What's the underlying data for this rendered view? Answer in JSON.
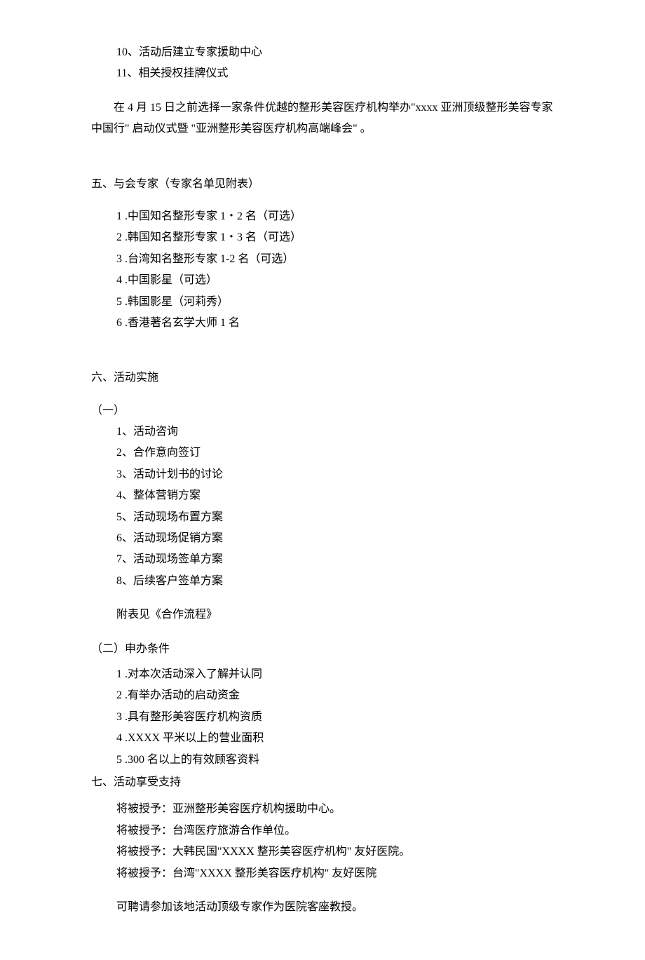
{
  "top_items": [
    "10、活动后建立专家援助中心",
    "11、相关授权挂牌仪式"
  ],
  "intro_para": "在 4 月 15 日之前选择一家条件优越的整形美容医疗机构举办\"xxxx 亚洲顶级整形美容专家中国行\" 启动仪式暨 \"亚洲整形美容医疗机构高端峰会\" 。",
  "section5": {
    "title": "五、与会专家（专家名单见附表）",
    "items": [
      "1  .中国知名整形专家 1・2 名（可选）",
      "2  .韩国知名整形专家 1・3 名（可选）",
      "3  .台湾知名整形专家 1-2 名（可选）",
      "4  .中国影星（可选）",
      "5  .韩国影星（河莉秀）",
      "6  .香港著名玄学大师 1 名"
    ]
  },
  "section6": {
    "title": "六、活动实施",
    "sub1_label": "（一）",
    "sub1_items": [
      "1、活动咨询",
      "2、合作意向签订",
      "3、活动计划书的讨论",
      "4、整体营销方案",
      "5、活动现场布置方案",
      "6、活动现场促销方案",
      "7、活动现场签单方案",
      "8、后续客户签单方案"
    ],
    "attach": "附表见《合作流程》",
    "sub2_label": "（二）申办条件",
    "sub2_items": [
      "1  .对本次活动深入了解并认同",
      "2  .有举办活动的启动资金",
      "3  .具有整形美容医疗机构资质",
      "4  .XXXX 平米以上的营业面积",
      "5  .300 名以上的有效顾客资料"
    ]
  },
  "section7": {
    "title": "七、活动享受支持",
    "items": [
      "将被授予：亚洲整形美容医疗机构援助中心。",
      "将被授予：台湾医疗旅游合作单位。",
      "将被授予：大韩民国\"XXXX 整形美容医疗机构\" 友好医院。",
      "将被授予：台湾\"XXXX 整形美容医疗机构\" 友好医院"
    ],
    "closing": "可聘请参加该地活动顶级专家作为医院客座教授。"
  }
}
